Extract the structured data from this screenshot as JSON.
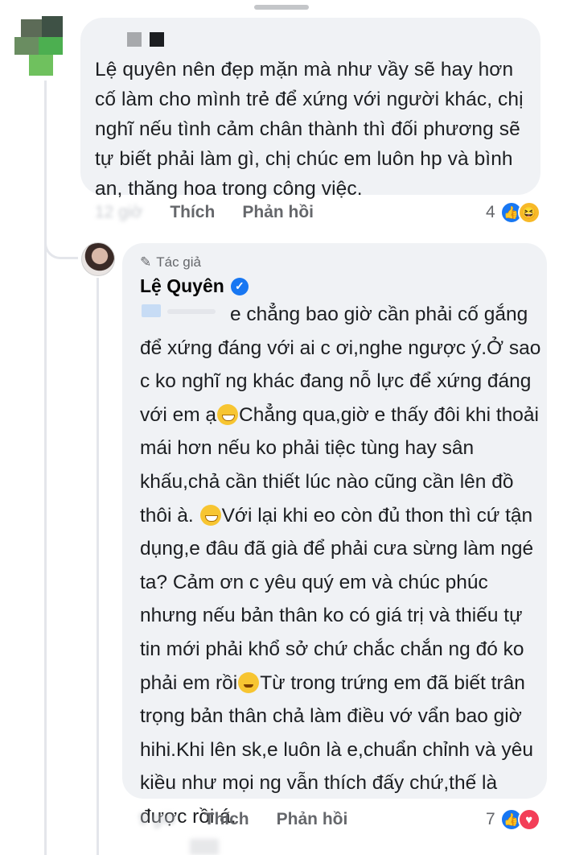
{
  "comment_1": {
    "text": "Lệ quyên nên đẹp mặn mà như vầy sẽ hay hơn cố làm cho mình trẻ để xứng với người khác, chị nghĩ nếu tình cảm chân thành thì đối phương sẽ tự biết phải làm gì, chị chúc em luôn hp và bình an, thăng hoa trong công việc.",
    "time": "12 giờ",
    "like_label": "Thích",
    "reply_label": "Phản hồi",
    "reaction_count": "4",
    "reactions": [
      "like-icon",
      "haha-icon"
    ]
  },
  "reply": {
    "badge": "Tác giả",
    "author": "Lệ Quyên",
    "verified": true,
    "text_part_1": "e chẳng bao giờ cần phải cố gắng để xứng đáng với ai c ơi,nghe ngược ý.Ở sao c ko nghĩ ng khác đang nỗ lực để xứng đáng với em ạ",
    "text_part_2": "Chẳng qua,giờ e thấy đôi khi thoải mái hơn nếu ko phải tiệc tùng hay sân khấu,chả cần thiết lúc nào cũng cần lên đồ thôi à.",
    "text_part_3": "Với lại khi eo còn đủ thon thì cứ tận dụng,e đâu đã già để phải cưa sừng làm ngé ta? Cảm ơn c yêu quý em và chúc phúc nhưng nếu bản thân ko có giá trị và thiếu tự tin mới phải khổ sở chứ chắc chắn ng đó ko phải em rồi",
    "text_part_4": "Từ trong trứng em đã biết trân trọng bản thân chả làm điều vớ vẩn bao giờ hihi.Khi lên sk,e luôn là e,chuẩn chỉnh và yêu kiều như mọi ng vẫn thích đấy chứ,thế là được rồi á.",
    "time": "9 giờ",
    "like_label": "Thích",
    "reply_label": "Phản hồi",
    "reaction_count": "7",
    "reactions": [
      "like-icon",
      "love-icon"
    ]
  },
  "colors": {
    "bubble": "#f0f2f5",
    "meta": "#65676b",
    "like": "#1877f2",
    "love": "#f33e58",
    "haha": "#f7b928"
  }
}
